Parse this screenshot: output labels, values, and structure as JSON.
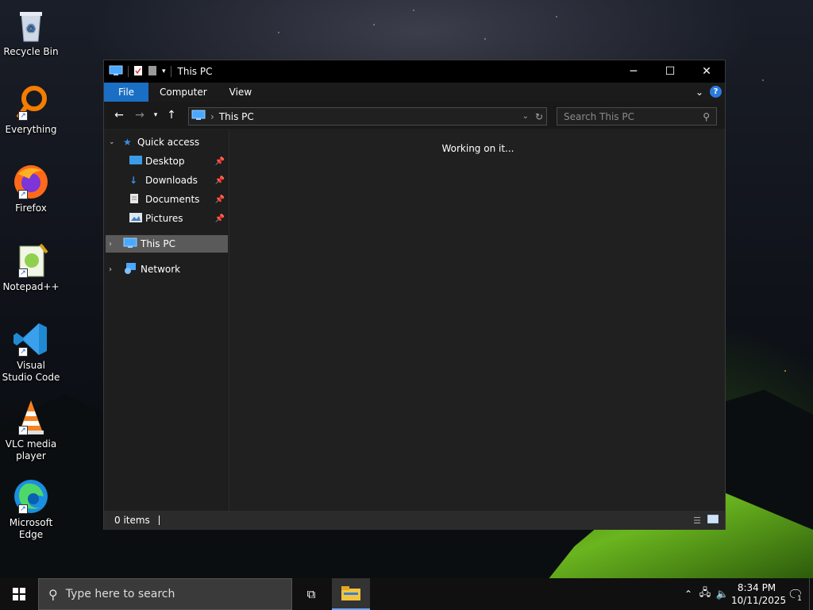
{
  "desktop": {
    "icons": [
      {
        "label": "Recycle Bin",
        "icon": "recycle-bin-icon"
      },
      {
        "label": "Everything",
        "icon": "everything-icon"
      },
      {
        "label": "Firefox",
        "icon": "firefox-icon"
      },
      {
        "label": "Notepad++",
        "icon": "notepad-plus-plus-icon"
      },
      {
        "label": "Visual Studio Code",
        "icon": "vscode-icon"
      },
      {
        "label": "VLC media player",
        "icon": "vlc-icon"
      },
      {
        "label": "Microsoft Edge",
        "icon": "edge-icon"
      }
    ]
  },
  "window": {
    "title": "This PC",
    "ribbon": {
      "tabs": [
        "File",
        "Computer",
        "View"
      ],
      "help": "?"
    },
    "address": {
      "location": "This PC"
    },
    "search": {
      "placeholder": "Search This PC"
    },
    "nav": {
      "quick_access": "Quick access",
      "pinned": [
        "Desktop",
        "Downloads",
        "Documents",
        "Pictures"
      ],
      "this_pc": "This PC",
      "network": "Network"
    },
    "content": {
      "message": "Working on it..."
    },
    "status": {
      "items": "0 items"
    }
  },
  "taskbar": {
    "search_placeholder": "Type here to search",
    "time": "8:34 PM",
    "date": "10/11/2025",
    "notification_count": "1"
  },
  "colors": {
    "accent": "#1a6fc4",
    "window_bg": "#202020",
    "selected": "#5a5a5a"
  }
}
